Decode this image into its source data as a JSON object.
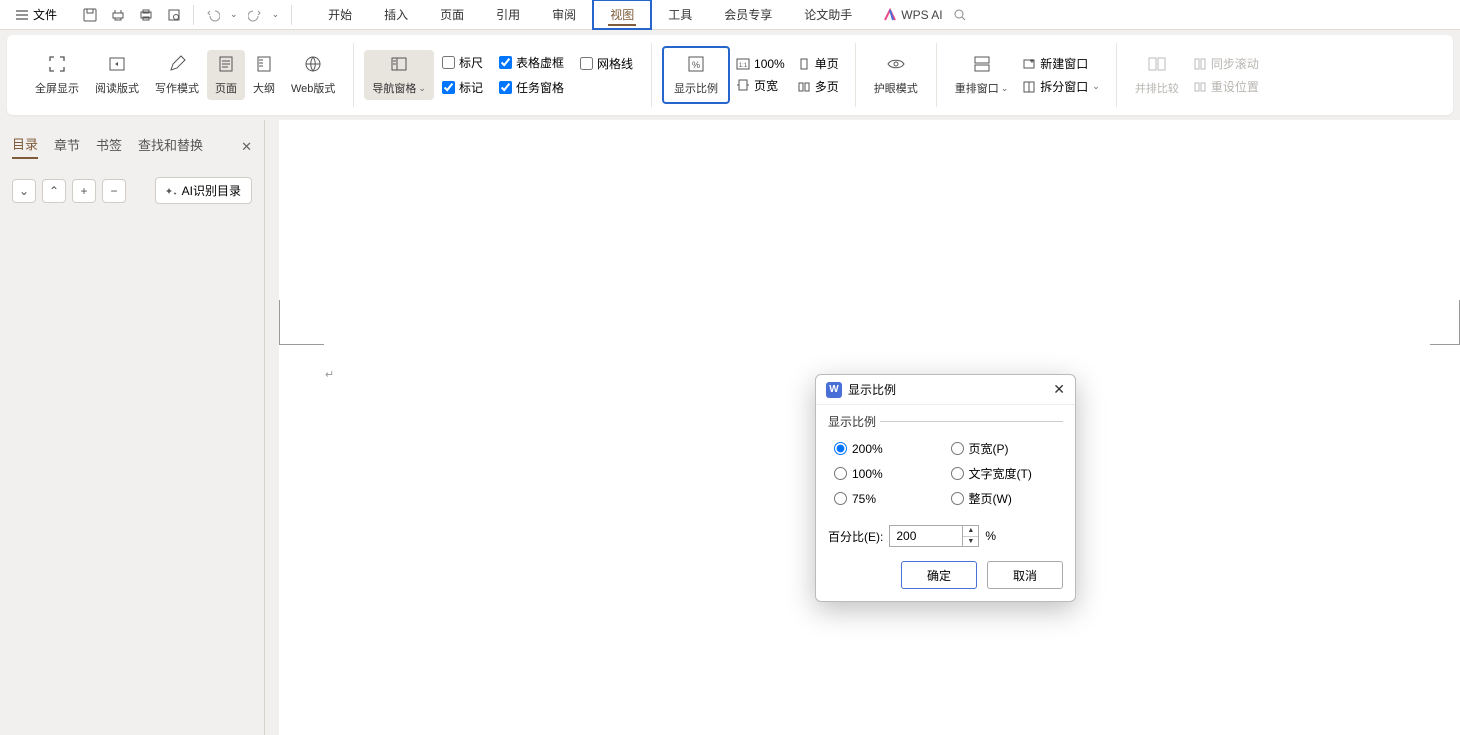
{
  "menubar": {
    "file": "文件",
    "tabs": [
      "开始",
      "插入",
      "页面",
      "引用",
      "审阅",
      "视图",
      "工具",
      "会员专享",
      "论文助手"
    ],
    "active_tab_index": 5,
    "wps_ai": "WPS AI"
  },
  "ribbon": {
    "fullscreen": "全屏显示",
    "reading": "阅读版式",
    "writing": "写作模式",
    "page": "页面",
    "outline": "大纲",
    "web": "Web版式",
    "nav_pane": "导航窗格",
    "ruler": "标尺",
    "table_frame": "表格虚框",
    "gridlines": "网格线",
    "marks": "标记",
    "task_pane": "任务窗格",
    "zoom": "显示比例",
    "hundred": "100%",
    "single_page": "单页",
    "page_width": "页宽",
    "multi_page": "多页",
    "eye_care": "护眼模式",
    "arrange_windows": "重排窗口",
    "new_window": "新建窗口",
    "split_window": "拆分窗口",
    "side_by_side": "并排比较",
    "sync_scroll": "同步滚动",
    "reset_position": "重设位置"
  },
  "sidebar": {
    "tabs": [
      "目录",
      "章节",
      "书签",
      "查找和替换"
    ],
    "active_tab_index": 0,
    "ai_toc": "AI识别目录"
  },
  "dialog": {
    "title": "显示比例",
    "section_label": "显示比例",
    "radios": {
      "r200": "200%",
      "page_width_p": "页宽(P)",
      "r100": "100%",
      "text_width_t": "文字宽度(T)",
      "r75": "75%",
      "whole_page_w": "整页(W)"
    },
    "percent_label": "百分比(E):",
    "percent_value": "200",
    "percent_sign": "%",
    "ok": "确定",
    "cancel": "取消"
  }
}
